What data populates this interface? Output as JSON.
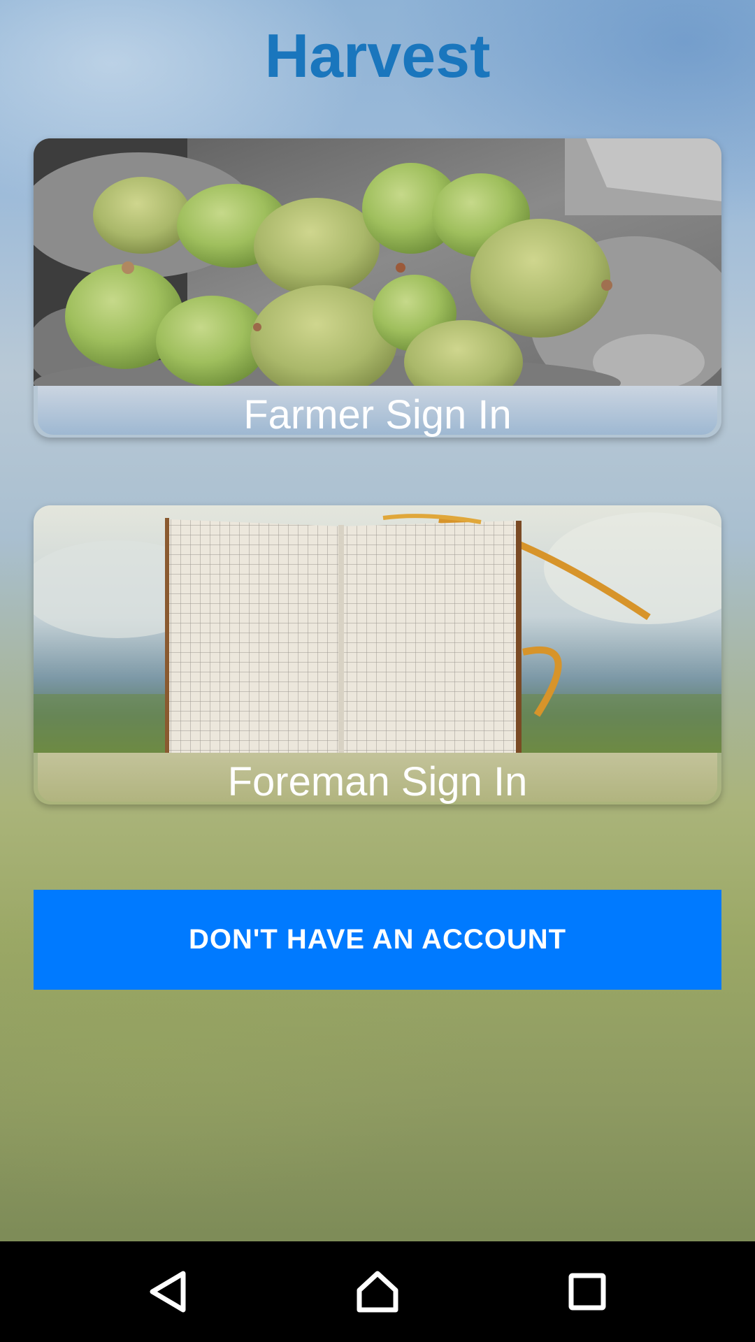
{
  "app": {
    "title": "Harvest",
    "title_color": "#1a76bd"
  },
  "cards": {
    "farmer": {
      "label": "Farmer Sign In",
      "image": "macadamia-nuts-in-hands-photo"
    },
    "foreman": {
      "label": "Foreman Sign In",
      "image": "open-grid-notebook-photo"
    }
  },
  "signup": {
    "label": "DON'T HAVE AN ACCOUNT",
    "color": "#007aff"
  },
  "navbar": {
    "icons": [
      "back-icon",
      "home-icon",
      "recent-apps-icon"
    ]
  }
}
